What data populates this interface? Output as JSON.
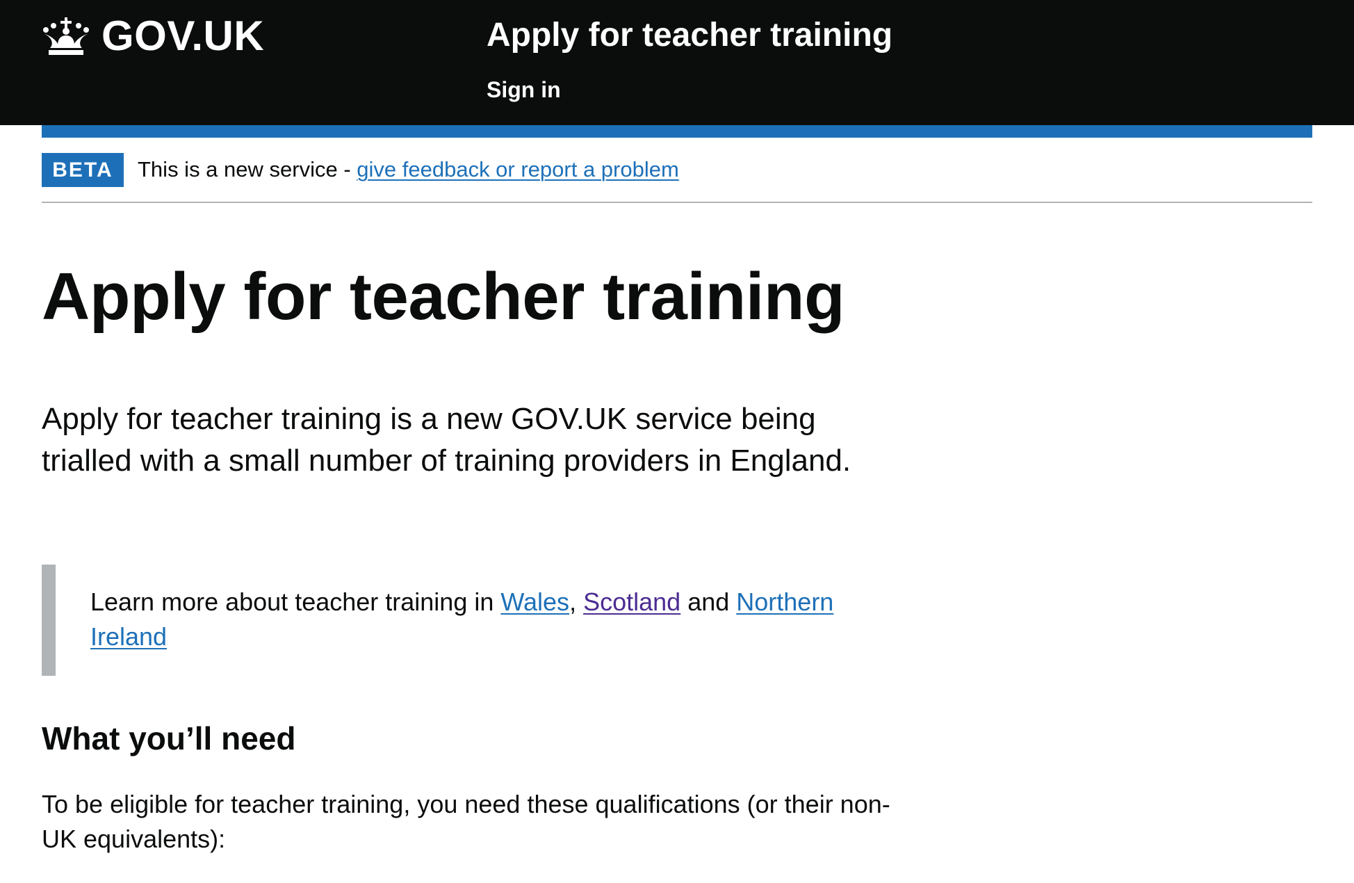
{
  "header": {
    "logo_text": "GOV.UK",
    "service_name": "Apply for teacher training",
    "nav": {
      "sign_in": "Sign in"
    }
  },
  "phase_banner": {
    "tag": "BETA",
    "text": "This is a new service - ",
    "link_text": "give feedback or report a problem"
  },
  "main": {
    "title": "Apply for teacher training",
    "lead": "Apply for teacher training is a new GOV.UK service being trialled with a small number of training providers in England.",
    "inset": {
      "prefix": "Learn more about teacher training in ",
      "links": {
        "wales": "Wales",
        "scotland": "Scotland",
        "northern_ireland": "Northern Ireland"
      },
      "comma": ", ",
      "and": " and "
    },
    "section_heading": "What you’ll need",
    "section_body": "To be eligible for teacher training, you need these qualifications (or their non-UK equivalents):"
  },
  "colors": {
    "header_bg": "#0b0c0c",
    "link": "#1d70b8",
    "link_visited": "#4c2c92",
    "tag_bg": "#1d70b8",
    "inset_border": "#b1b4b6",
    "divider": "#b1b4b6"
  },
  "icons": {
    "logo_icon": "crown-icon"
  }
}
